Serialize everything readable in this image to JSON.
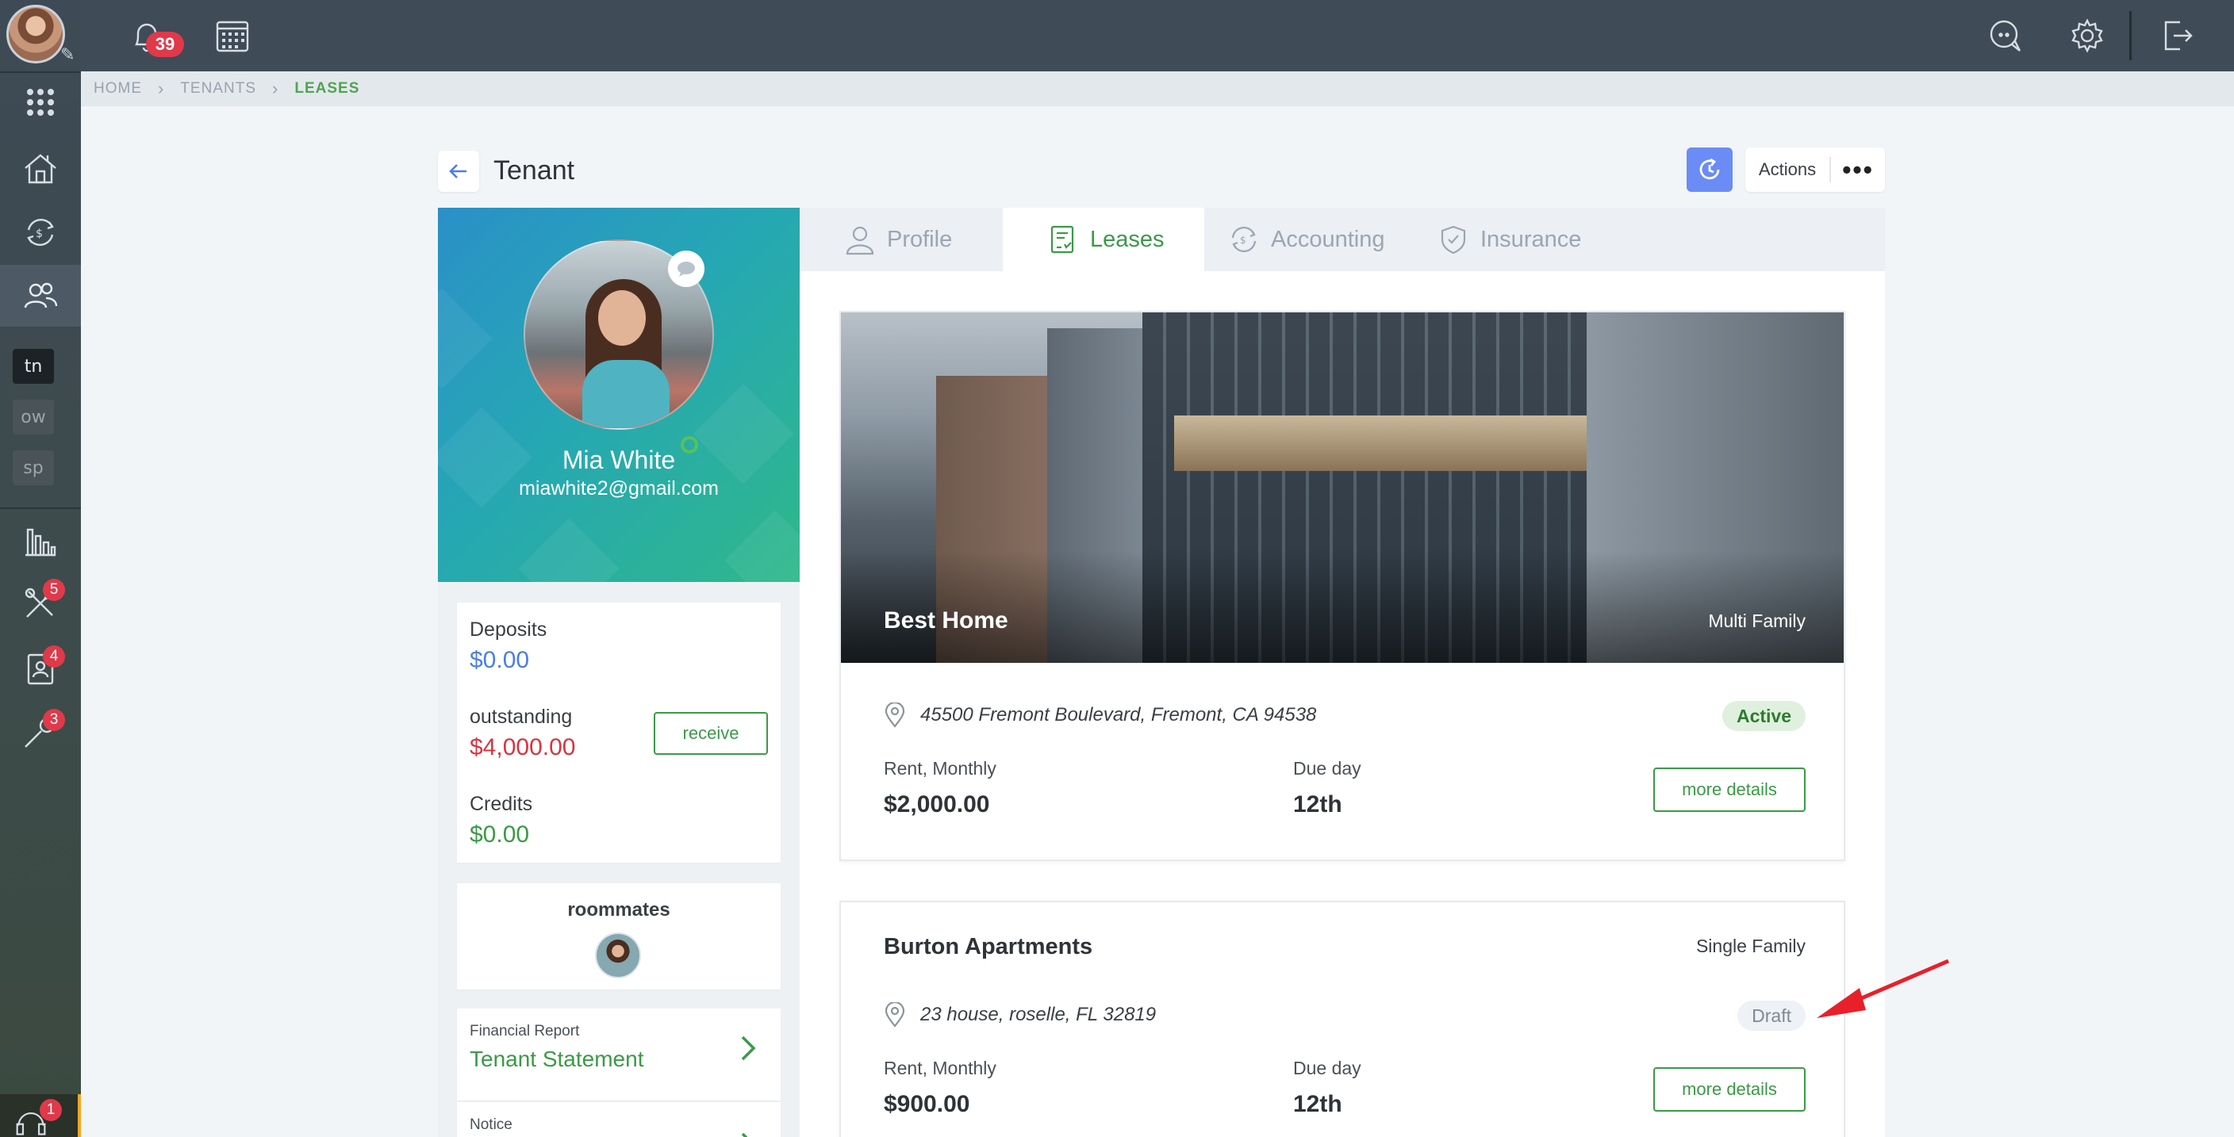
{
  "topbar": {
    "notification_count": "39"
  },
  "sidebar": {
    "items": [
      {
        "name": "apps",
        "badge": ""
      },
      {
        "name": "properties",
        "badge": ""
      },
      {
        "name": "payments",
        "badge": ""
      },
      {
        "name": "tenants",
        "badge": ""
      },
      {
        "name": "reports",
        "badge": ""
      },
      {
        "name": "maintenance",
        "badge": "5"
      },
      {
        "name": "applications",
        "badge": "4"
      },
      {
        "name": "tools",
        "badge": "3"
      },
      {
        "name": "support",
        "badge": "1"
      }
    ],
    "switchers": [
      "tn",
      "ow",
      "sp"
    ]
  },
  "breadcrumb": {
    "items": [
      "HOME",
      "TENANTS",
      "LEASES"
    ]
  },
  "page": {
    "title": "Tenant",
    "actions_label": "Actions",
    "more_label": "•••"
  },
  "tenant": {
    "name": "Mia White",
    "email": "miawhite2@gmail.com"
  },
  "finance": {
    "deposits_label": "Deposits",
    "deposits_value": "$0.00",
    "outstanding_label": "outstanding",
    "outstanding_value": "$4,000.00",
    "receive_label": "receive",
    "credits_label": "Credits",
    "credits_value": "$0.00"
  },
  "roommates": {
    "title": "roommates"
  },
  "financial_report": {
    "small": "Financial Report",
    "link": "Tenant Statement"
  },
  "notice": {
    "small": "Notice"
  },
  "tabs": [
    {
      "label": "Profile",
      "active": false
    },
    {
      "label": "Leases",
      "active": true
    },
    {
      "label": "Accounting",
      "active": false
    },
    {
      "label": "Insurance",
      "active": false
    }
  ],
  "leases": [
    {
      "title": "Best Home",
      "type": "Multi Family",
      "address": "45500 Fremont Boulevard, Fremont, CA 94538",
      "status": "Active",
      "rent_label": "Rent, Monthly",
      "rent_value": "$2,000.00",
      "due_label": "Due day",
      "due_value": "12th",
      "button": "more details"
    },
    {
      "title": "Burton Apartments",
      "type": "Single Family",
      "address": "23 house, roselle, FL 32819",
      "status": "Draft",
      "rent_label": "Rent, Monthly",
      "rent_value": "$900.00",
      "due_label": "Due day",
      "due_value": "12th",
      "button": "more details"
    }
  ],
  "colors": {
    "accent_green": "#3a9a46",
    "accent_blue": "#6b8cf5",
    "danger_red": "#d9343f",
    "sidebar_dark": "#3e4a55"
  }
}
